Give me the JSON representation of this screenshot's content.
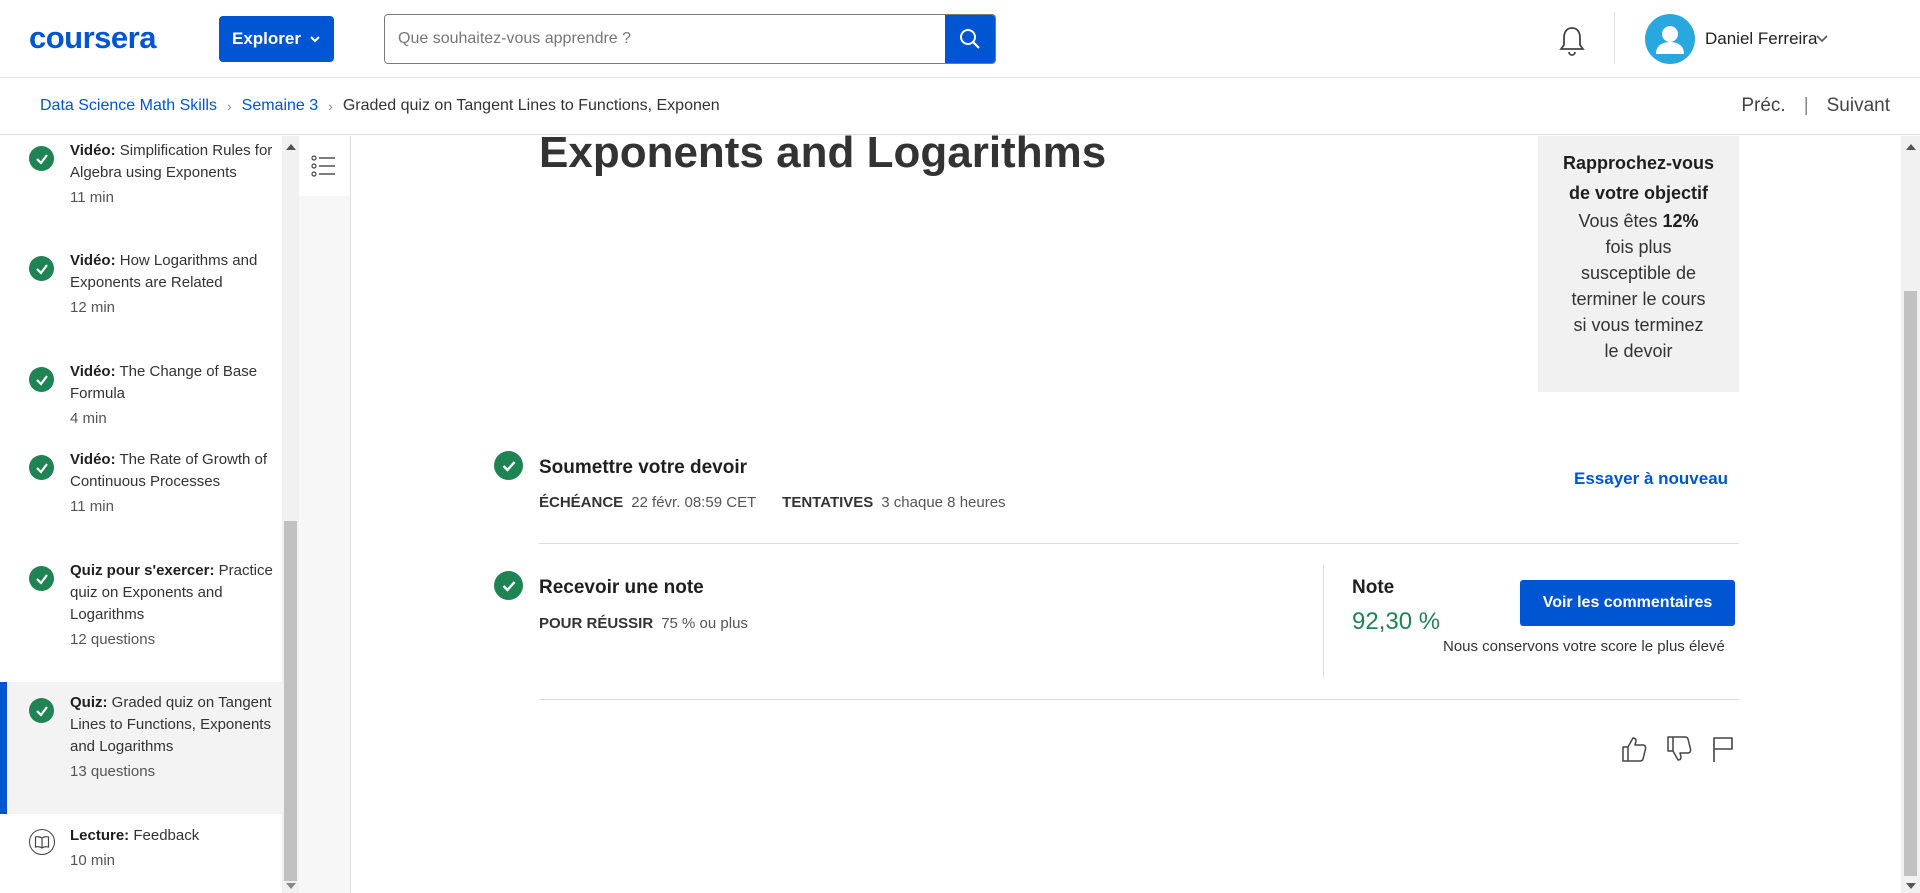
{
  "header": {
    "logo": "coursera",
    "explore_label": "Explorer",
    "search_placeholder": "Que souhaitez-vous apprendre ?",
    "username": "Daniel Ferreira"
  },
  "breadcrumb": {
    "items": [
      "Data Science Math Skills",
      "Semaine 3"
    ],
    "current": "Graded quiz on Tangent Lines to Functions, Exponents and Logarithms",
    "prev_label": "Préc.",
    "next_label": "Suivant"
  },
  "sidebar": {
    "items": [
      {
        "kind": "Vidéo:",
        "title": "Simplification Rules for Algebra using Exponents",
        "meta": "11 min",
        "icon": "check-icon",
        "completed": true
      },
      {
        "kind": "Vidéo:",
        "title": "How Logarithms and Exponents are Related",
        "meta": "12 min",
        "icon": "check-icon",
        "completed": true
      },
      {
        "kind": "Vidéo:",
        "title": "The Change of Base Formula",
        "meta": "4 min",
        "icon": "check-icon",
        "completed": true
      },
      {
        "kind": "Vidéo:",
        "title": "The Rate of Growth of Continuous Processes",
        "meta": "11 min",
        "icon": "check-icon",
        "completed": true
      },
      {
        "kind": "Quiz pour s'exercer:",
        "title": "Practice quiz on Exponents and Logarithms",
        "meta": "12 questions",
        "icon": "check-icon",
        "completed": true
      },
      {
        "kind": "Quiz:",
        "title": "Graded quiz on Tangent Lines to Functions, Exponents and Logarithms",
        "meta": "13 questions",
        "icon": "check-icon",
        "completed": true,
        "active": true
      },
      {
        "kind": "Lecture:",
        "title": "Feedback",
        "meta": "10 min",
        "icon": "book-icon",
        "completed": false
      }
    ]
  },
  "main": {
    "title": "Exponents and Logarithms",
    "goal": {
      "title": "Rapprochez-vous de votre objectif",
      "text_before": "Vous êtes ",
      "percent": "12%",
      "text_after": " fois plus susceptible de terminer le cours si vous terminez le devoir"
    },
    "submit": {
      "title": "Soumettre votre devoir",
      "due_label": "ÉCHÉANCE",
      "due_value": "22 févr. 08:59 CET",
      "attempts_label": "TENTATIVES",
      "attempts_value": "3 chaque 8 heures",
      "retry_label": "Essayer à nouveau"
    },
    "grade": {
      "title": "Recevoir une note",
      "pass_label": "POUR RÉUSSIR",
      "pass_value": "75 % ou plus",
      "note_label": "Note",
      "note_value": "92,30 %",
      "feedback_button": "Voir les commentaires",
      "score_note": "Nous conservons votre score le plus élevé"
    }
  },
  "colors": {
    "brand": "#0056d2",
    "success": "#1f8354",
    "goal_bg": "#f1f1f1"
  }
}
